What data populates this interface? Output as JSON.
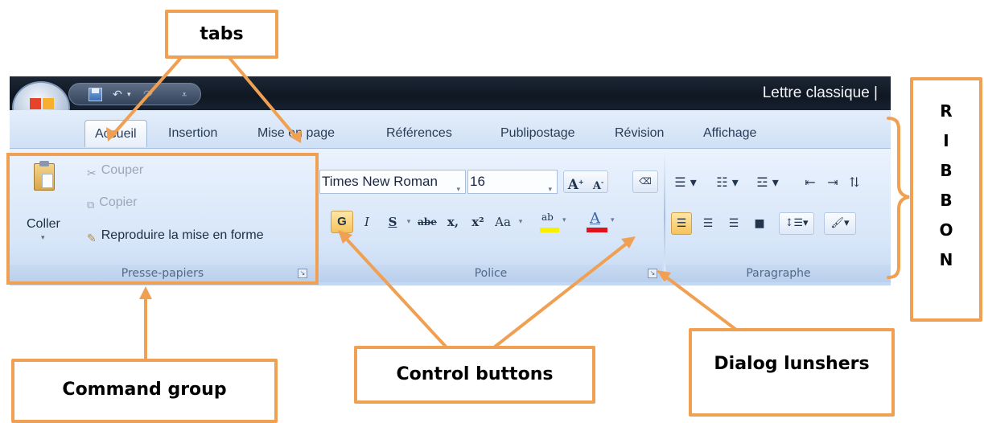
{
  "window": {
    "document_title": "Lettre classique |"
  },
  "tabs": [
    "Accueil",
    "Insertion",
    "Mise en page",
    "Références",
    "Publipostage",
    "Révision",
    "Affichage"
  ],
  "groups": {
    "clipboard": {
      "label": "Presse-papiers",
      "paste_label": "Coller",
      "cut_label": "Couper",
      "copy_label": "Copier",
      "format_painter_label": "Reproduire la mise en forme"
    },
    "font": {
      "label": "Police",
      "font_name": "Times New Roman",
      "font_size": "16",
      "bold": "G",
      "italic": "I",
      "underline": "S",
      "strike": "abe",
      "subscript": "x,",
      "superscript": "x²",
      "change_case": "Aa",
      "grow": "A",
      "shrink": "A",
      "highlight": "ab",
      "font_color": "A"
    },
    "paragraph": {
      "label": "Paragraphe"
    }
  },
  "annotations": {
    "tabs": "tabs",
    "ribbon_letters": [
      "R",
      "I",
      "B",
      "B",
      "O",
      "N"
    ],
    "command_group": "Command group",
    "control_buttons": "Control buttons",
    "dialog_launchers": "Dialog lunshers"
  },
  "colors": {
    "annotation_orange": "#f0a052",
    "titlebar": "#0f1722",
    "ribbon": "#d6e5f8",
    "highlight_yellow": "#f7f000",
    "font_color_red": "#e0121b"
  }
}
